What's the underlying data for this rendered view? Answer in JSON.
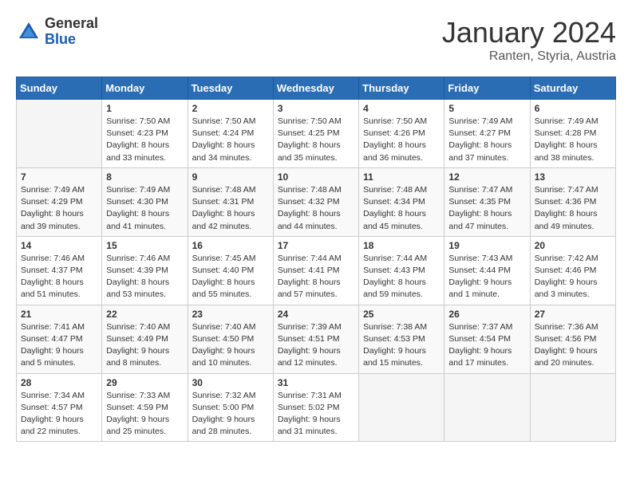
{
  "header": {
    "logo_general": "General",
    "logo_blue": "Blue",
    "month_title": "January 2024",
    "subtitle": "Ranten, Styria, Austria"
  },
  "days_of_week": [
    "Sunday",
    "Monday",
    "Tuesday",
    "Wednesday",
    "Thursday",
    "Friday",
    "Saturday"
  ],
  "weeks": [
    [
      {
        "day": "",
        "info": ""
      },
      {
        "day": "1",
        "info": "Sunrise: 7:50 AM\nSunset: 4:23 PM\nDaylight: 8 hours\nand 33 minutes."
      },
      {
        "day": "2",
        "info": "Sunrise: 7:50 AM\nSunset: 4:24 PM\nDaylight: 8 hours\nand 34 minutes."
      },
      {
        "day": "3",
        "info": "Sunrise: 7:50 AM\nSunset: 4:25 PM\nDaylight: 8 hours\nand 35 minutes."
      },
      {
        "day": "4",
        "info": "Sunrise: 7:50 AM\nSunset: 4:26 PM\nDaylight: 8 hours\nand 36 minutes."
      },
      {
        "day": "5",
        "info": "Sunrise: 7:49 AM\nSunset: 4:27 PM\nDaylight: 8 hours\nand 37 minutes."
      },
      {
        "day": "6",
        "info": "Sunrise: 7:49 AM\nSunset: 4:28 PM\nDaylight: 8 hours\nand 38 minutes."
      }
    ],
    [
      {
        "day": "7",
        "info": "Sunrise: 7:49 AM\nSunset: 4:29 PM\nDaylight: 8 hours\nand 39 minutes."
      },
      {
        "day": "8",
        "info": "Sunrise: 7:49 AM\nSunset: 4:30 PM\nDaylight: 8 hours\nand 41 minutes."
      },
      {
        "day": "9",
        "info": "Sunrise: 7:48 AM\nSunset: 4:31 PM\nDaylight: 8 hours\nand 42 minutes."
      },
      {
        "day": "10",
        "info": "Sunrise: 7:48 AM\nSunset: 4:32 PM\nDaylight: 8 hours\nand 44 minutes."
      },
      {
        "day": "11",
        "info": "Sunrise: 7:48 AM\nSunset: 4:34 PM\nDaylight: 8 hours\nand 45 minutes."
      },
      {
        "day": "12",
        "info": "Sunrise: 7:47 AM\nSunset: 4:35 PM\nDaylight: 8 hours\nand 47 minutes."
      },
      {
        "day": "13",
        "info": "Sunrise: 7:47 AM\nSunset: 4:36 PM\nDaylight: 8 hours\nand 49 minutes."
      }
    ],
    [
      {
        "day": "14",
        "info": "Sunrise: 7:46 AM\nSunset: 4:37 PM\nDaylight: 8 hours\nand 51 minutes."
      },
      {
        "day": "15",
        "info": "Sunrise: 7:46 AM\nSunset: 4:39 PM\nDaylight: 8 hours\nand 53 minutes."
      },
      {
        "day": "16",
        "info": "Sunrise: 7:45 AM\nSunset: 4:40 PM\nDaylight: 8 hours\nand 55 minutes."
      },
      {
        "day": "17",
        "info": "Sunrise: 7:44 AM\nSunset: 4:41 PM\nDaylight: 8 hours\nand 57 minutes."
      },
      {
        "day": "18",
        "info": "Sunrise: 7:44 AM\nSunset: 4:43 PM\nDaylight: 8 hours\nand 59 minutes."
      },
      {
        "day": "19",
        "info": "Sunrise: 7:43 AM\nSunset: 4:44 PM\nDaylight: 9 hours\nand 1 minute."
      },
      {
        "day": "20",
        "info": "Sunrise: 7:42 AM\nSunset: 4:46 PM\nDaylight: 9 hours\nand 3 minutes."
      }
    ],
    [
      {
        "day": "21",
        "info": "Sunrise: 7:41 AM\nSunset: 4:47 PM\nDaylight: 9 hours\nand 5 minutes."
      },
      {
        "day": "22",
        "info": "Sunrise: 7:40 AM\nSunset: 4:49 PM\nDaylight: 9 hours\nand 8 minutes."
      },
      {
        "day": "23",
        "info": "Sunrise: 7:40 AM\nSunset: 4:50 PM\nDaylight: 9 hours\nand 10 minutes."
      },
      {
        "day": "24",
        "info": "Sunrise: 7:39 AM\nSunset: 4:51 PM\nDaylight: 9 hours\nand 12 minutes."
      },
      {
        "day": "25",
        "info": "Sunrise: 7:38 AM\nSunset: 4:53 PM\nDaylight: 9 hours\nand 15 minutes."
      },
      {
        "day": "26",
        "info": "Sunrise: 7:37 AM\nSunset: 4:54 PM\nDaylight: 9 hours\nand 17 minutes."
      },
      {
        "day": "27",
        "info": "Sunrise: 7:36 AM\nSunset: 4:56 PM\nDaylight: 9 hours\nand 20 minutes."
      }
    ],
    [
      {
        "day": "28",
        "info": "Sunrise: 7:34 AM\nSunset: 4:57 PM\nDaylight: 9 hours\nand 22 minutes."
      },
      {
        "day": "29",
        "info": "Sunrise: 7:33 AM\nSunset: 4:59 PM\nDaylight: 9 hours\nand 25 minutes."
      },
      {
        "day": "30",
        "info": "Sunrise: 7:32 AM\nSunset: 5:00 PM\nDaylight: 9 hours\nand 28 minutes."
      },
      {
        "day": "31",
        "info": "Sunrise: 7:31 AM\nSunset: 5:02 PM\nDaylight: 9 hours\nand 31 minutes."
      },
      {
        "day": "",
        "info": ""
      },
      {
        "day": "",
        "info": ""
      },
      {
        "day": "",
        "info": ""
      }
    ]
  ]
}
